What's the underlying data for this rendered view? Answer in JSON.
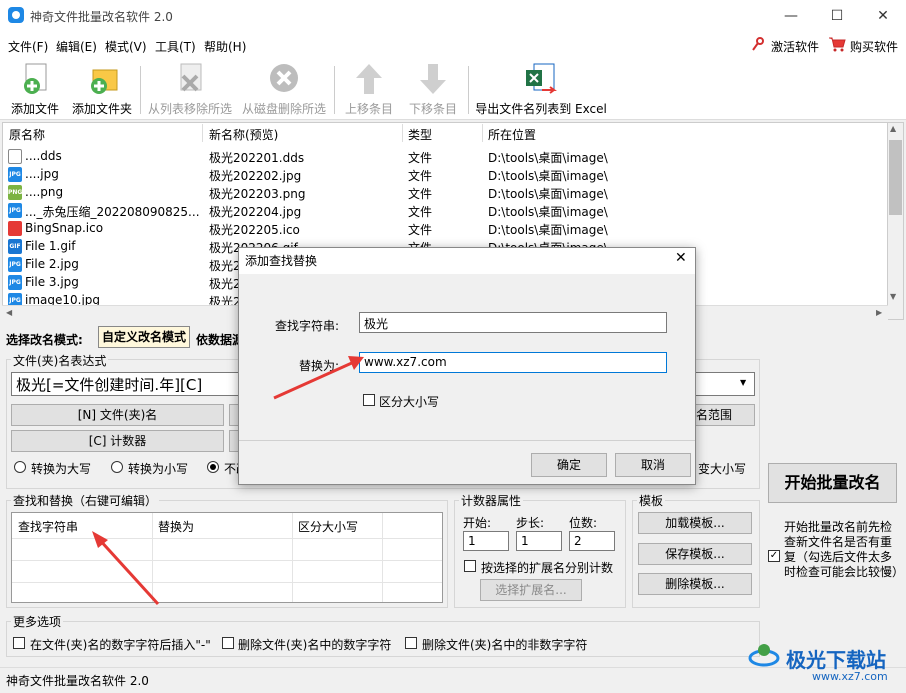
{
  "window": {
    "title": "神奇文件批量改名软件 2.0",
    "minimize": "—",
    "maximize": "☐",
    "close": "✕"
  },
  "menu": {
    "items": [
      "文件(F)",
      "编辑(E)",
      "模式(V)",
      "工具(T)",
      "帮助(H)"
    ],
    "activate": "激活软件",
    "buy": "购买软件"
  },
  "toolbar": {
    "add_file": "添加文件",
    "add_folder": "添加文件夹",
    "remove_from_list": "从列表移除所选",
    "delete_from_disk": "从磁盘删除所选",
    "move_up": "上移条目",
    "move_down": "下移条目",
    "export_excel": "导出文件名列表到 Excel"
  },
  "filelist": {
    "columns": [
      "原名称",
      "新名称(预览)",
      "类型",
      "所在位置"
    ],
    "rows": [
      {
        "icon": "dds-file-icon",
        "orig": "....dds",
        "new": "极光202201.dds",
        "type": "文件",
        "loc": "D:\\tools\\桌面\\image\\"
      },
      {
        "icon": "jpg-file-icon",
        "orig": "....jpg",
        "new": "极光202202.jpg",
        "type": "文件",
        "loc": "D:\\tools\\桌面\\image\\"
      },
      {
        "icon": "png-file-icon",
        "orig": "....png",
        "new": "极光202203.png",
        "type": "文件",
        "loc": "D:\\tools\\桌面\\image\\"
      },
      {
        "icon": "jpg-file-icon",
        "orig": "..._赤兔压缩_202208090825...",
        "new": "极光202204.jpg",
        "type": "文件",
        "loc": "D:\\tools\\桌面\\image\\"
      },
      {
        "icon": "ico-file-icon",
        "orig": "BingSnap.ico",
        "new": "极光202205.ico",
        "type": "文件",
        "loc": "D:\\tools\\桌面\\image\\"
      },
      {
        "icon": "gif-file-icon",
        "orig": "File 1.gif",
        "new": "极光202206.gif",
        "type": "文件",
        "loc": "D:\\tools\\桌面\\image\\"
      },
      {
        "icon": "jpg-file-icon",
        "orig": "File 2.jpg",
        "new": "极光2",
        "type": "",
        "loc": ""
      },
      {
        "icon": "jpg-file-icon",
        "orig": "File 3.jpg",
        "new": "极光2",
        "type": "",
        "loc": ""
      },
      {
        "icon": "jpg-file-icon",
        "orig": "image10.jpg",
        "new": "极光2",
        "type": "",
        "loc": ""
      }
    ]
  },
  "mode": {
    "label": "选择改名模式:",
    "custom_tab": "自定义改名模式",
    "data_tab": "依数据源"
  },
  "expression": {
    "group_title": "文件(夹)名表达式",
    "value": "极光[=文件创建时间.年][C]",
    "btn_name": "[N] 文件(夹)名",
    "btn_counter": "[C] 计数器",
    "btn_range": "名范围",
    "radio_upper": "转换为大写",
    "radio_lower": "转换为小写",
    "radio_none": "不改",
    "radio_right": "变大小写"
  },
  "start_button": "开始批量改名",
  "check_dup": "开始批量改名前先检查新文件名是否有重复（勾选后文件太多时检查可能会比较慢）",
  "find_replace": {
    "group_title": "查找和替换（右键可编辑）",
    "columns": [
      "查找字符串",
      "替换为",
      "区分大小写"
    ]
  },
  "counter": {
    "group_title": "计数器属性",
    "start_label": "开始:",
    "step_label": "步长:",
    "digits_label": "位数:",
    "start": "1",
    "step": "1",
    "digits": "2",
    "by_ext": "按选择的扩展名分别计数",
    "select_ext": "选择扩展名..."
  },
  "template": {
    "group_title": "模板",
    "load": "加载模板...",
    "save": "保存模板...",
    "delete": "删除模板..."
  },
  "more": {
    "group_title": "更多选项",
    "opt1": "在文件(夹)名的数字字符后插入\"-\"",
    "opt2": "删除文件(夹)名中的数字字符",
    "opt3": "删除文件(夹)名中的非数字字符"
  },
  "status": "神奇文件批量改名软件 2.0",
  "watermark": "极光下载站",
  "watermark_url": "www.xz7.com",
  "dialog": {
    "title": "添加查找替换",
    "find_label": "查找字符串:",
    "find_value": "极光",
    "replace_label": "替换为:",
    "replace_value": "www.xz7.com",
    "case_label": "区分大小写",
    "ok": "确定",
    "cancel": "取消"
  },
  "colors": {
    "accent": "#1e88e5",
    "arrow": "#e53935",
    "excel_green": "#217346"
  }
}
